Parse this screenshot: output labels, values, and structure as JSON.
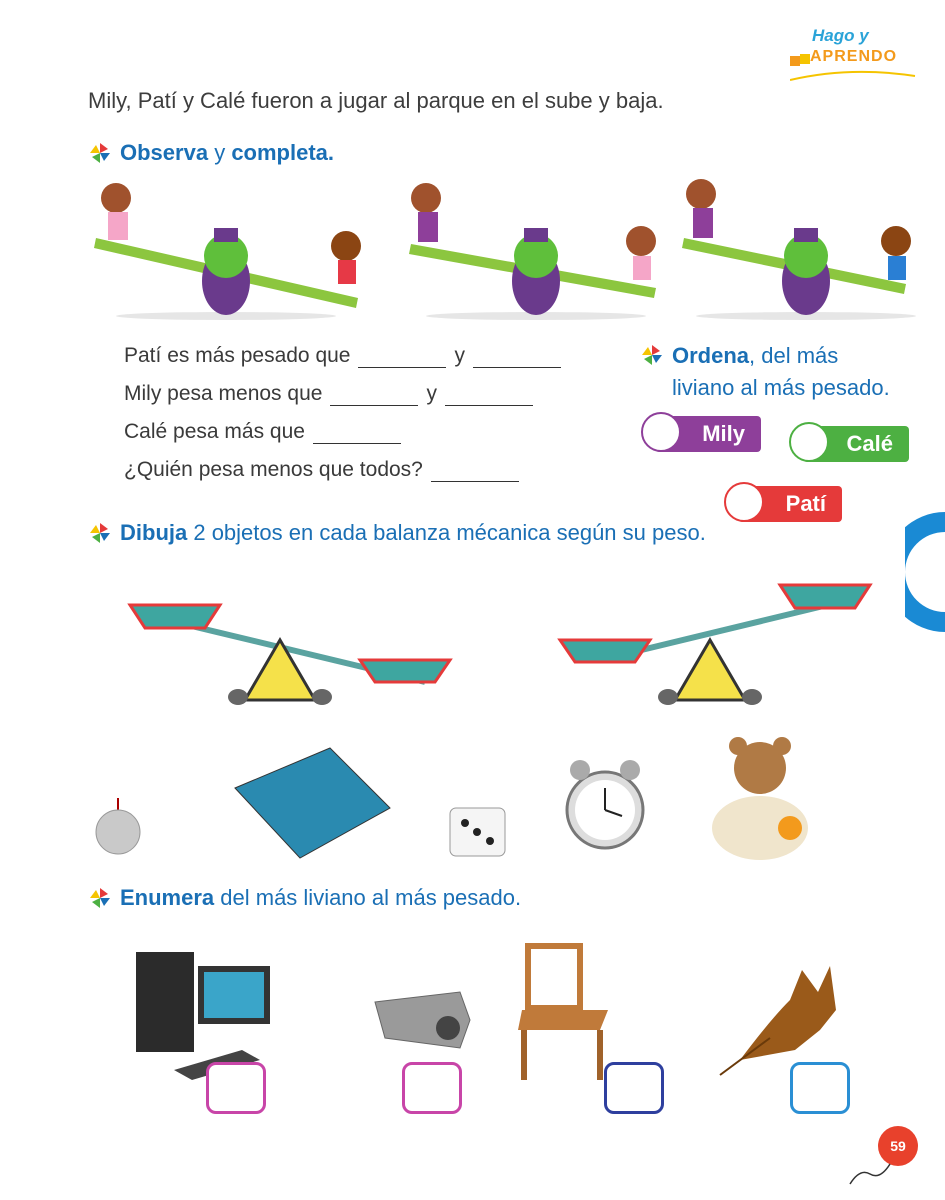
{
  "logo": {
    "line1": "Hago y",
    "line2": "Aprendo"
  },
  "intro": "Mily, Patí y Calé fueron a jugar al parque en el sube y baja.",
  "section1": {
    "verb": "Observa",
    "conj": "y",
    "verb2": "completa."
  },
  "questions": {
    "q1a": "Patí es más pesado que",
    "q1b": "y",
    "q2a": "Mily pesa menos que",
    "q2b": "y",
    "q3": "Calé pesa más que",
    "q4": "¿Quién pesa menos que todos?"
  },
  "order": {
    "verb": "Ordena",
    "rest1": ", del más",
    "rest2": "liviano al más pesado."
  },
  "tags": {
    "mily": "Mily",
    "cale": "Calé",
    "pati": "Patí"
  },
  "section2": {
    "verb": "Dibuja",
    "rest": " 2 objetos en cada balanza mécanica según su peso."
  },
  "section3": {
    "verb": "Enumera",
    "rest": " del más liviano al más pesado."
  },
  "page_number": "59",
  "colors": {
    "blue": "#1a6fb5",
    "purple": "#8e3f9a",
    "green": "#4db042",
    "red": "#e53a3a"
  }
}
